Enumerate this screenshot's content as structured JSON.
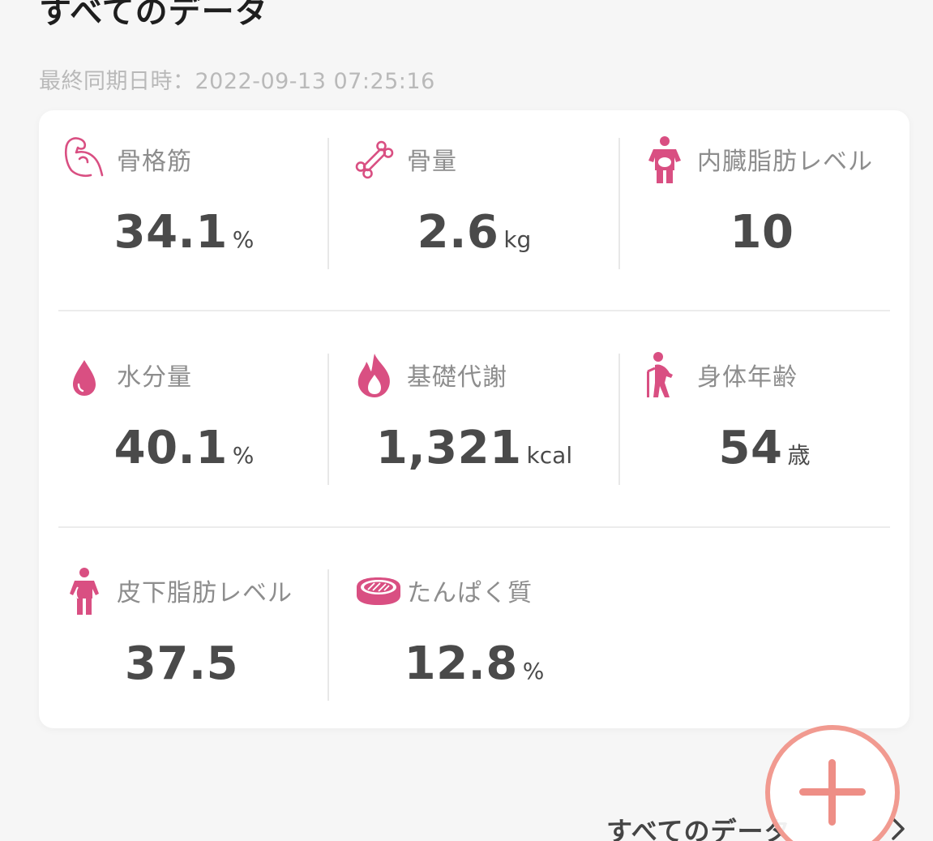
{
  "header": {
    "title": "すべてのデータ",
    "sync_time": "最終同期日時：2022-09-13 07:25:16"
  },
  "metrics": [
    {
      "label": "骨格筋",
      "value": "34.1",
      "unit": "%",
      "icon": "muscle-icon"
    },
    {
      "label": "骨量",
      "value": "2.6",
      "unit": "kg",
      "icon": "bone-icon"
    },
    {
      "label": "内臓脂肪レベル",
      "value": "10",
      "unit": "",
      "icon": "visceral-fat-icon"
    },
    {
      "label": "水分量",
      "value": "40.1",
      "unit": "%",
      "icon": "water-drop-icon"
    },
    {
      "label": "基礎代謝",
      "value": "1,321",
      "unit": "kcal",
      "icon": "flame-icon"
    },
    {
      "label": "身体年齢",
      "value": "54",
      "unit": "歳",
      "icon": "elderly-person-icon"
    },
    {
      "label": "皮下脂肪レベル",
      "value": "37.5",
      "unit": "",
      "icon": "body-fat-person-icon"
    },
    {
      "label": "たんぱく質",
      "value": "12.8",
      "unit": "%",
      "icon": "steak-icon"
    }
  ],
  "fab": {
    "icon": "plus-icon"
  },
  "footer": {
    "link_label": "すべてのデータ",
    "chevron_icon": "chevron-right-icon"
  },
  "colors": {
    "accent": "#d94f82",
    "fab": "#f19a90",
    "card": "#ffffff",
    "background": "#f6f6f6"
  }
}
